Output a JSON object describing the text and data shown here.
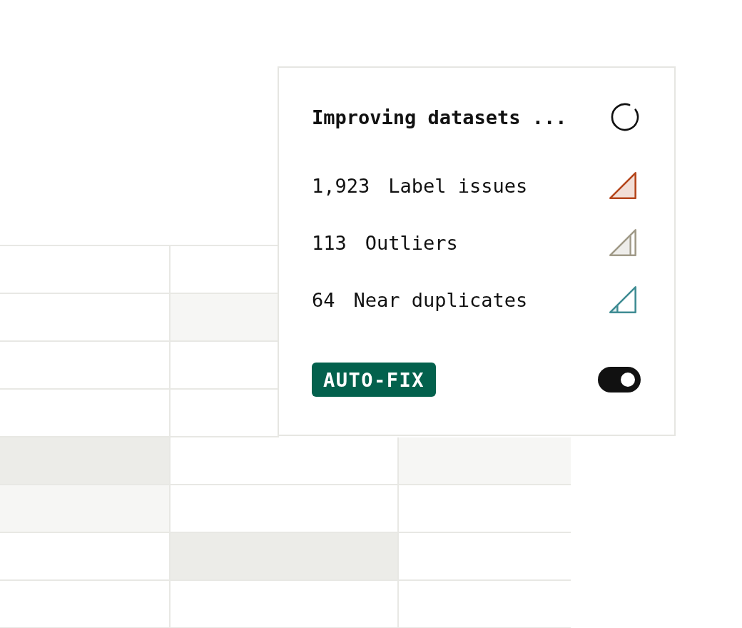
{
  "status_card": {
    "title": "Improving datasets ...",
    "issues": [
      {
        "count": "1,923",
        "label": "Label issues",
        "level": 1,
        "color": "#b5461c"
      },
      {
        "count": "113",
        "label": "Outliers",
        "level": 0.78,
        "color": "#a09a88"
      },
      {
        "count": "64",
        "label": "Near duplicates",
        "level": 0.3,
        "color": "#3f8c93"
      }
    ],
    "auto_fix": {
      "label": "AUTO-FIX",
      "on": true
    }
  },
  "table": {
    "rows": [
      {
        "cells": [
          {
            "color": "#ffffff"
          },
          {
            "color": "#ffffff"
          }
        ]
      },
      {
        "cells": [
          {
            "color": "#ffffff"
          },
          {
            "color": "#f6f6f4"
          }
        ]
      },
      {
        "cells": [
          {
            "color": "#ffffff"
          },
          {
            "color": "#ffffff"
          }
        ]
      },
      {
        "cells": [
          {
            "color": "#ffffff"
          },
          {
            "color": "#ffffff"
          }
        ]
      },
      {
        "cells": [
          {
            "color": "#ecece8"
          },
          {
            "color": "#ffffff"
          },
          {
            "color": "#f6f6f4"
          }
        ]
      },
      {
        "cells": [
          {
            "color": "#f6f6f4"
          },
          {
            "color": "#ffffff"
          },
          {
            "color": "#ffffff"
          }
        ]
      },
      {
        "cells": [
          {
            "color": "#ffffff"
          },
          {
            "color": "#ecece8"
          },
          {
            "color": "#ffffff"
          }
        ]
      },
      {
        "cells": [
          {
            "color": "#ffffff"
          },
          {
            "color": "#ffffff"
          },
          {
            "color": "#ffffff"
          }
        ]
      }
    ]
  }
}
